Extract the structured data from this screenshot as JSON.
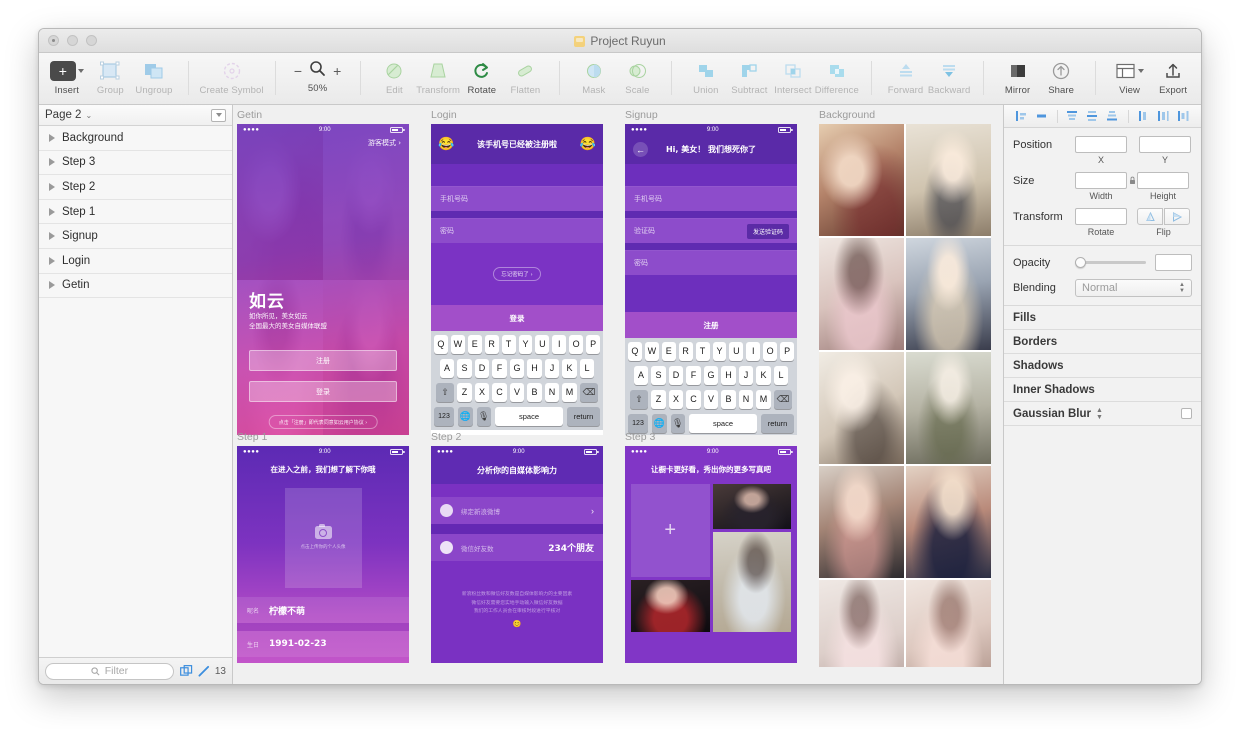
{
  "window": {
    "title": "Project Ruyun",
    "traffic_lights": [
      "close",
      "minimize",
      "zoom"
    ]
  },
  "toolbar": {
    "items": [
      {
        "label": "Insert",
        "icon": "plus-icon",
        "enabled": true
      },
      {
        "label": "Group",
        "icon": "group-icon",
        "enabled": false
      },
      {
        "label": "Ungroup",
        "icon": "ungroup-icon",
        "enabled": false
      },
      {
        "label": "Create Symbol",
        "icon": "create-symbol-icon",
        "enabled": false
      },
      {
        "label": "Edit",
        "icon": "edit-icon",
        "enabled": false
      },
      {
        "label": "Transform",
        "icon": "transform-icon",
        "enabled": false
      },
      {
        "label": "Rotate",
        "icon": "rotate-icon",
        "enabled": true
      },
      {
        "label": "Flatten",
        "icon": "flatten-icon",
        "enabled": false
      },
      {
        "label": "Mask",
        "icon": "mask-icon",
        "enabled": false
      },
      {
        "label": "Scale",
        "icon": "scale-icon",
        "enabled": false
      },
      {
        "label": "Union",
        "icon": "union-icon",
        "enabled": false
      },
      {
        "label": "Subtract",
        "icon": "subtract-icon",
        "enabled": false
      },
      {
        "label": "Intersect",
        "icon": "intersect-icon",
        "enabled": false
      },
      {
        "label": "Difference",
        "icon": "difference-icon",
        "enabled": false
      },
      {
        "label": "Forward",
        "icon": "forward-icon",
        "enabled": false
      },
      {
        "label": "Backward",
        "icon": "backward-icon",
        "enabled": false
      },
      {
        "label": "Mirror",
        "icon": "mirror-icon",
        "enabled": true
      },
      {
        "label": "Share",
        "icon": "share-icon",
        "enabled": true
      },
      {
        "label": "View",
        "icon": "view-icon",
        "enabled": true
      },
      {
        "label": "Export",
        "icon": "export-icon",
        "enabled": true
      }
    ],
    "zoom": {
      "label": "50%",
      "minus": "−",
      "plus": "+",
      "icon": "magnifier-icon"
    }
  },
  "sidebar": {
    "page": {
      "name": "Page 2",
      "chevron": "⌄"
    },
    "layers": [
      {
        "name": "Background"
      },
      {
        "name": "Step 3"
      },
      {
        "name": "Step 2"
      },
      {
        "name": "Step 1"
      },
      {
        "name": "Signup"
      },
      {
        "name": "Login"
      },
      {
        "name": "Getin"
      }
    ],
    "footer": {
      "filter_placeholder": "Filter",
      "count": "13"
    }
  },
  "canvas": {
    "artboards": [
      {
        "name": "Getin"
      },
      {
        "name": "Login"
      },
      {
        "name": "Signup"
      },
      {
        "name": "Background"
      },
      {
        "name": "Step 1"
      },
      {
        "name": "Step 2"
      },
      {
        "name": "Step 3"
      }
    ]
  },
  "getin": {
    "status_time": "9:00",
    "guest_link": "游客模式 ›",
    "brand": "如云",
    "tagline_line1": "如你所见，美女如云",
    "tagline_line2": "全国最大的美女自媒体联盟",
    "signup_button": "注册",
    "login_button": "登录",
    "footnote": "点击「注册」即代表同意如云用户协议 ›"
  },
  "login": {
    "title": "该手机号已经被注册啦",
    "emoji_left": "😂",
    "emoji_right": "😂",
    "phone_placeholder": "手机号码",
    "password_placeholder": "密码",
    "forgot": "忘记密码了 ›",
    "submit": "登录"
  },
  "signup": {
    "status_time": "9:00",
    "title": "Hi, 美女！ 我们想死你了",
    "back_icon": "back-arrow-icon",
    "phone_placeholder": "手机号码",
    "code_placeholder": "验证码",
    "code_button": "发送验证码",
    "password_placeholder": "密码",
    "submit": "注册"
  },
  "keyboard": {
    "row1": [
      "Q",
      "W",
      "E",
      "R",
      "T",
      "Y",
      "U",
      "I",
      "O",
      "P"
    ],
    "row2": [
      "A",
      "S",
      "D",
      "F",
      "G",
      "H",
      "J",
      "K",
      "L"
    ],
    "row3": [
      "Z",
      "X",
      "C",
      "V",
      "B",
      "N",
      "M"
    ],
    "shift": "⇧",
    "delete": "⌫",
    "numbers": "123",
    "globe": "🌐",
    "mic": "🎙",
    "space": "space",
    "return": "return"
  },
  "step1": {
    "status_time": "9:00",
    "title": "在进入之前，我们想了解下你哦",
    "photo_hint": "点击上传你的个人头像",
    "camera_icon": "camera-icon",
    "fields": [
      {
        "label": "昵名",
        "value": "柠檬不萌"
      },
      {
        "label": "生日",
        "value": "1991-02-23"
      }
    ]
  },
  "step2": {
    "status_time": "9:00",
    "title": "分析你的自媒体影响力",
    "rows": [
      {
        "icon": "weibo-icon",
        "label": "绑定新浪微博",
        "value": "›"
      },
      {
        "icon": "wechat-icon",
        "label": "微信好友数",
        "value": "234个朋友"
      }
    ],
    "note_line1": "新浪粉丝数和微信好友数是自媒体影响力的主要因素",
    "note_line2": "微信好友需要您实地手动输入微信好友数据",
    "note_line3": "我们的工作人员会在审核时段进行平核对",
    "note_emoji": "😊"
  },
  "step3": {
    "status_time": "9:00",
    "title": "让橱卡更好看，秀出你的更多写真吧",
    "add_icon": "plus-icon",
    "photos": [
      "photo-night-portrait",
      "photo-beach-portrait",
      "photo-red-stripe"
    ]
  },
  "background": {
    "photos": [
      "photo-kimono",
      "photo-green-dress",
      "photo-pink-gown",
      "photo-navy-dress",
      "photo-swing",
      "photo-street-shorts",
      "photo-fur-coat",
      "photo-lace-dress",
      "photo-pink-lace",
      "photo-pink-knit"
    ]
  },
  "inspector": {
    "align_buttons": [
      "align-left-icon",
      "align-center-h-icon",
      "align-top-icon",
      "align-middle-icon",
      "align-bottom-icon",
      "distribute-h-icon",
      "distribute-v-icon",
      "distribute-icon"
    ],
    "position": {
      "label": "Position",
      "x_value": "",
      "y_value": "",
      "x_caption": "X",
      "y_caption": "Y"
    },
    "size": {
      "label": "Size",
      "width_value": "",
      "height_value": "",
      "width_caption": "Width",
      "height_caption": "Height",
      "lock_icon": "lock-icon"
    },
    "transform": {
      "label": "Transform",
      "rotate_value": "",
      "rotate_caption": "Rotate",
      "flip_caption": "Flip",
      "flip_h_icon": "flip-horizontal-icon",
      "flip_v_icon": "flip-vertical-icon"
    },
    "opacity": {
      "label": "Opacity",
      "value": "",
      "slider_percent": 0
    },
    "blending": {
      "label": "Blending",
      "value": "Normal"
    },
    "sections": [
      {
        "label": "Fills"
      },
      {
        "label": "Borders"
      },
      {
        "label": "Shadows"
      },
      {
        "label": "Inner Shadows"
      },
      {
        "label": "Gaussian Blur",
        "has_stepper": true,
        "has_checkbox": true
      }
    ]
  }
}
